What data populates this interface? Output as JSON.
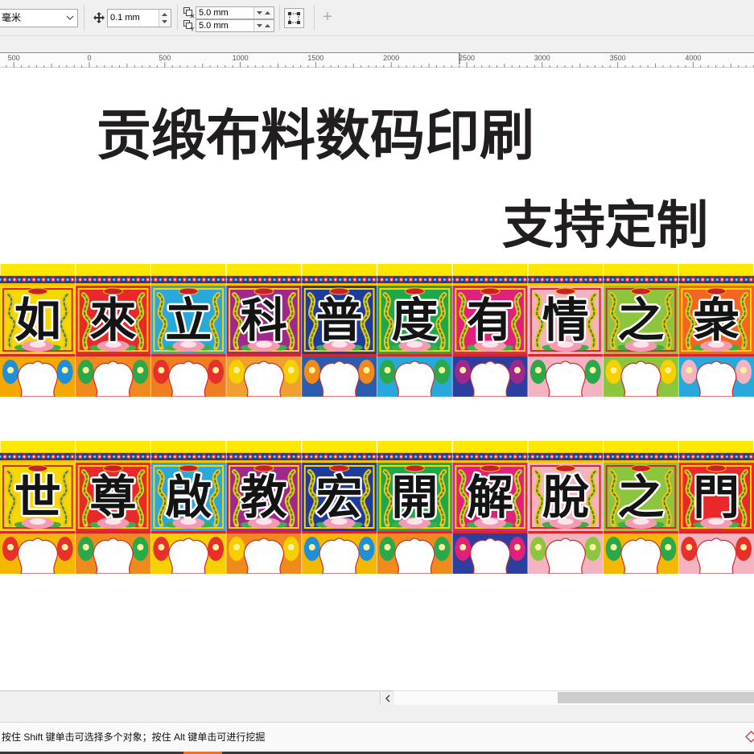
{
  "toolbar": {
    "units": "毫米",
    "nudge_distance": "0.1 mm",
    "duplicate_distance_x": "5.0 mm",
    "duplicate_distance_y": "5.0 mm",
    "add_button": "+"
  },
  "ruler": {
    "labels": [
      "500",
      "0",
      "500",
      "1000",
      "1500",
      "2000",
      "2500",
      "3000",
      "3500",
      "4000"
    ]
  },
  "canvas": {
    "title": "贡缎布料数码印刷",
    "subtitle": "支持定制",
    "banners": [
      {
        "chars": [
          "如",
          "來",
          "立",
          "科",
          "普",
          "度",
          "有",
          "情",
          "之",
          "衆"
        ],
        "panel_colors": [
          "#f5d800",
          "#e8282a",
          "#29a8dc",
          "#a0288c",
          "#1e3c9c",
          "#1fa84a",
          "#e0207a",
          "#f4b3c0",
          "#8cc63f",
          "#f26522"
        ],
        "bottom_colors": [
          "#f5a800",
          "#f08a1c",
          "#ef7d22",
          "#f0a030",
          "#2a5db0",
          "#29a8dc",
          "#2a3fa0",
          "#f4b3c0",
          "#8cc63f",
          "#29a8dc"
        ],
        "accent_colors": [
          "#1f8fd6",
          "#2aa84a",
          "#e8302a",
          "#f7d000",
          "#f08a1c",
          "#2aa84a",
          "#a0288c",
          "#2aa84a",
          "#f7d000",
          "#f4b3c0"
        ]
      },
      {
        "chars": [
          "世",
          "尊",
          "啟",
          "教",
          "宏",
          "開",
          "解",
          "脫",
          "之",
          "門"
        ],
        "panel_colors": [
          "#f5d800",
          "#e8282a",
          "#29a8dc",
          "#a0288c",
          "#1e3c9c",
          "#1fa84a",
          "#e0207a",
          "#f4b3c0",
          "#8cc63f",
          "#e8282a"
        ],
        "bottom_colors": [
          "#f5b800",
          "#f08a1c",
          "#f7d000",
          "#f08a1c",
          "#f5b800",
          "#f08a1c",
          "#2a3fa0",
          "#f4b3c0",
          "#f5b800",
          "#f4b3c0"
        ],
        "accent_colors": [
          "#e8302a",
          "#2aa84a",
          "#e8302a",
          "#f7d000",
          "#1f8fd6",
          "#2aa84a",
          "#e0207a",
          "#8cc63f",
          "#2aa84a",
          "#e8302a"
        ]
      }
    ]
  },
  "status": {
    "hint": "按住 Shift 键单击可选择多个对象；按住 Alt 键单击可进行挖掘"
  },
  "colors": {
    "ruler_accent": "#3fa7b8",
    "banner_yellow": "#ffe800",
    "title_text": "#221e1f",
    "scroll_thumb": "#cdcdcd",
    "taskbar_accent": "#e8732a"
  },
  "icons": {
    "units_dropdown": "chevron-down-icon",
    "nudge": "nudge-arrows-icon",
    "duplicate_x": "duplicate-x-icon",
    "duplicate_y": "duplicate-y-icon",
    "page_frame": "bounding-box-icon",
    "scroll_left": "chevron-left-icon",
    "fill_status": "fill-indicator-icon"
  }
}
